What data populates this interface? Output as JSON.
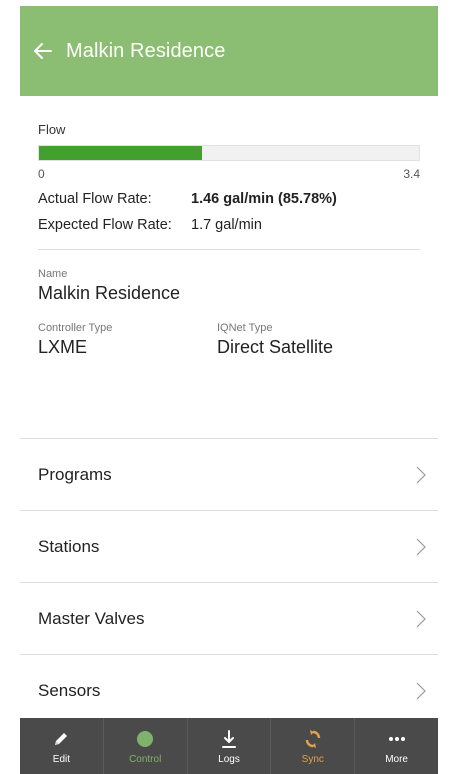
{
  "header": {
    "title": "Malkin Residence"
  },
  "flow": {
    "label": "Flow",
    "min": "0",
    "max": "3.4",
    "fill_fraction": 0.43,
    "bar_color": "#43a02f",
    "actual_label": "Actual Flow Rate:",
    "actual_value": "1.46 gal/min (85.78%)",
    "expected_label": "Expected Flow Rate:",
    "expected_value": "1.7 gal/min"
  },
  "details": {
    "name_label": "Name",
    "name_value": "Malkin Residence",
    "controller_label": "Controller Type",
    "controller_value": "LXME",
    "iqnet_label": "IQNet Type",
    "iqnet_value": "Direct Satellite"
  },
  "menu": [
    {
      "label": "Programs"
    },
    {
      "label": "Stations"
    },
    {
      "label": "Master Valves"
    },
    {
      "label": "Sensors"
    }
  ],
  "tabs": [
    {
      "label": "Edit",
      "icon": "pencil-icon"
    },
    {
      "label": "Control",
      "icon": "green-dot-icon"
    },
    {
      "label": "Logs",
      "icon": "download-icon"
    },
    {
      "label": "Sync",
      "icon": "sync-icon"
    },
    {
      "label": "More",
      "icon": "ellipsis-icon"
    }
  ],
  "colors": {
    "header": "#8bbd72",
    "tabbar": "#4a4a4a",
    "control": "#7fb26a",
    "sync": "#e0a24a"
  }
}
